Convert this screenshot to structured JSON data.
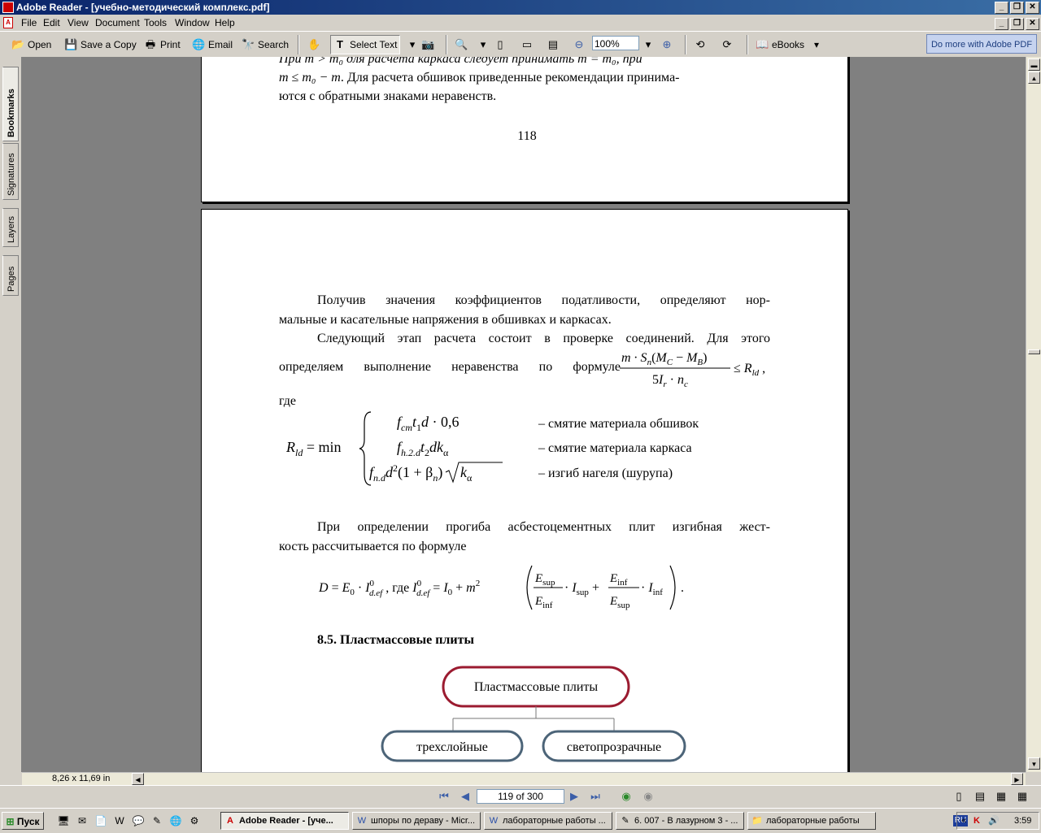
{
  "window": {
    "title": "Adobe Reader - [учебно-методический комплекс.pdf]",
    "controls": [
      "_",
      "❐",
      "✕"
    ]
  },
  "menu": [
    "File",
    "Edit",
    "View",
    "Document",
    "Tools",
    "Window",
    "Help"
  ],
  "toolbar": {
    "open": "Open",
    "save_copy": "Save a Copy",
    "print": "Print",
    "email": "Email",
    "search": "Search",
    "select_text": "Select Text",
    "zoom": "100%",
    "ebooks": "eBooks",
    "adobe_pdf": "Do more with Adobe PDF"
  },
  "nav_tabs": [
    "Bookmarks",
    "Signatures",
    "Layers",
    "Pages"
  ],
  "page_prev": {
    "line1": "При m > m₀ для расчета каркаса следует принимать m = m₀, при",
    "line2_a": "m ≤ m₀ − m",
    "line2_b": ". Для расчета обшивок приведенные рекомендации принима-",
    "line3": "ются с обратными знаками неравенств.",
    "page_number": "118"
  },
  "page": {
    "p1_l1": "Получив значения коэффициентов податливости, определяют нор-",
    "p1_l2": "мальные и касательные напряжения в обшивках и каркасах.",
    "p2_l1": "Следующий этап расчета состоит в проверке соединений. Для этого",
    "p2_l2": "определяем выполнение неравенства по формуле",
    "p2_where": "где",
    "rld_desc1": "–  смятие материала обшивок",
    "rld_desc2": "–  смятие материала каркаса",
    "rld_desc3": "–  изгиб нагеля (шурупа)",
    "p3_l1": "При определении прогиба асбестоцементных плит изгибная жест-",
    "p3_l2": "кость рассчитывается по формуле",
    "section": "8.5. Пластмассовые плиты",
    "diagram": {
      "root": "Пластмассовые плиты",
      "child1": "трехслойные",
      "child2": "светопрозрачные"
    }
  },
  "status": {
    "page_size": "8,26 x 11,69 in",
    "page_indicator": "119 of 300"
  },
  "taskbar": {
    "start": "Пуск",
    "tasks": [
      "Adobe Reader - [уче...",
      "шпоры по дераву - Micr...",
      "лабораторные работы ...",
      "6. 007 - В лазурном 3 - ...",
      "лабораторные работы"
    ],
    "lang": "RU",
    "clock": "3:59"
  }
}
